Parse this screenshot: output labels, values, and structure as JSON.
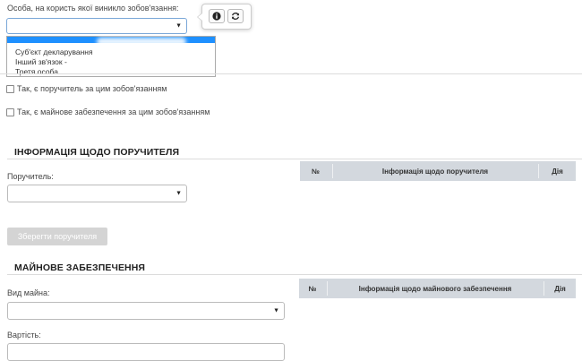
{
  "obligation": {
    "label": "Особа, на користь якої виникло зобов'язання:",
    "selected": "",
    "options": [
      "Суб'єкт декларування",
      "Інший зв'язок -",
      "Третя особа"
    ],
    "popover": {
      "info_icon": "info-icon",
      "refresh_icon": "refresh-icon"
    }
  },
  "checkboxes": {
    "guarantor": "Так, є поручитель за цим зобов'язанням",
    "collateral": "Так, є майнове забезпечення за цим зобов'язанням"
  },
  "guarantor_section": {
    "title": "ІНФОРМАЦІЯ ЩОДО ПОРУЧИТЕЛЯ",
    "field_label": "Поручитель:",
    "save_button": "Зберегти поручителя",
    "table_headers": [
      "№",
      "Інформація щодо поручителя",
      "Дія"
    ]
  },
  "collateral_section": {
    "title": "МАЙНОВЕ ЗАБЕЗПЕЧЕННЯ",
    "property_type_label": "Вид майна:",
    "value_label": "Вартість:",
    "table_headers": [
      "№",
      "Інформація щодо майнового забезпечення",
      "Дія"
    ]
  }
}
